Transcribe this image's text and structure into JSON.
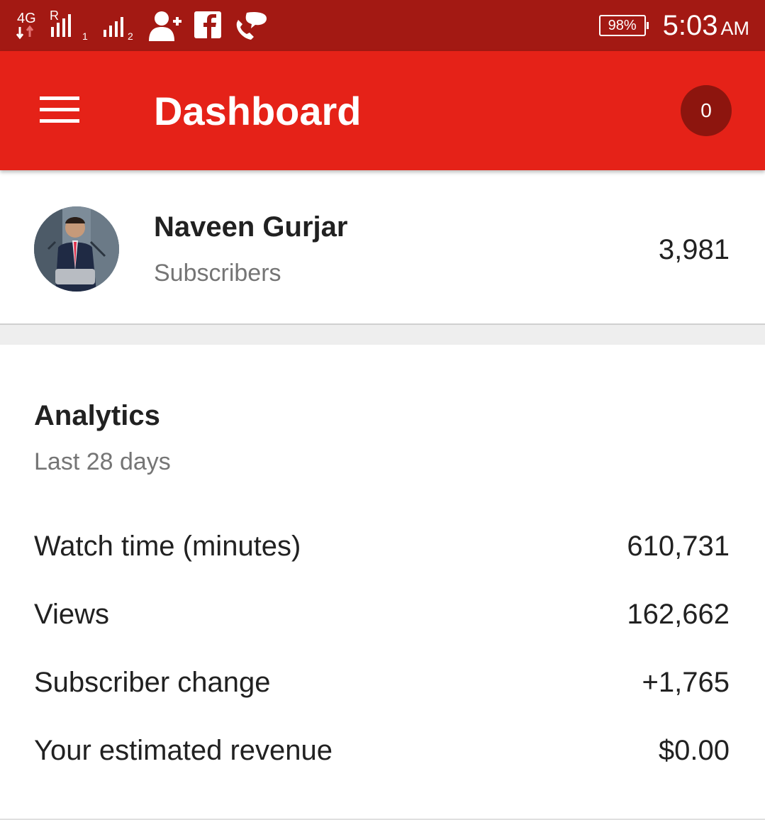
{
  "status_bar": {
    "network_label": "4G",
    "roaming_label": "R",
    "sim1_label": "1",
    "sim2_label": "2",
    "icons": [
      "network-4g-icon",
      "signal-sim1-icon",
      "signal-sim2-icon",
      "add-contact-icon",
      "facebook-icon",
      "chat-call-icon"
    ],
    "battery": "98%",
    "time": "5:03",
    "ampm": "AM"
  },
  "app_bar": {
    "title": "Dashboard",
    "notification_count": "0",
    "color": "#e52218"
  },
  "channel": {
    "name": "Naveen Gurjar",
    "subscribers_label": "Subscribers",
    "subscribers_count": "3,981"
  },
  "analytics": {
    "title": "Analytics",
    "period": "Last 28 days",
    "metrics": [
      {
        "label": "Watch time (minutes)",
        "value": "610,731"
      },
      {
        "label": "Views",
        "value": "162,662"
      },
      {
        "label": "Subscriber change",
        "value": "+1,765"
      },
      {
        "label": "Your estimated revenue",
        "value": "$0.00"
      }
    ]
  }
}
